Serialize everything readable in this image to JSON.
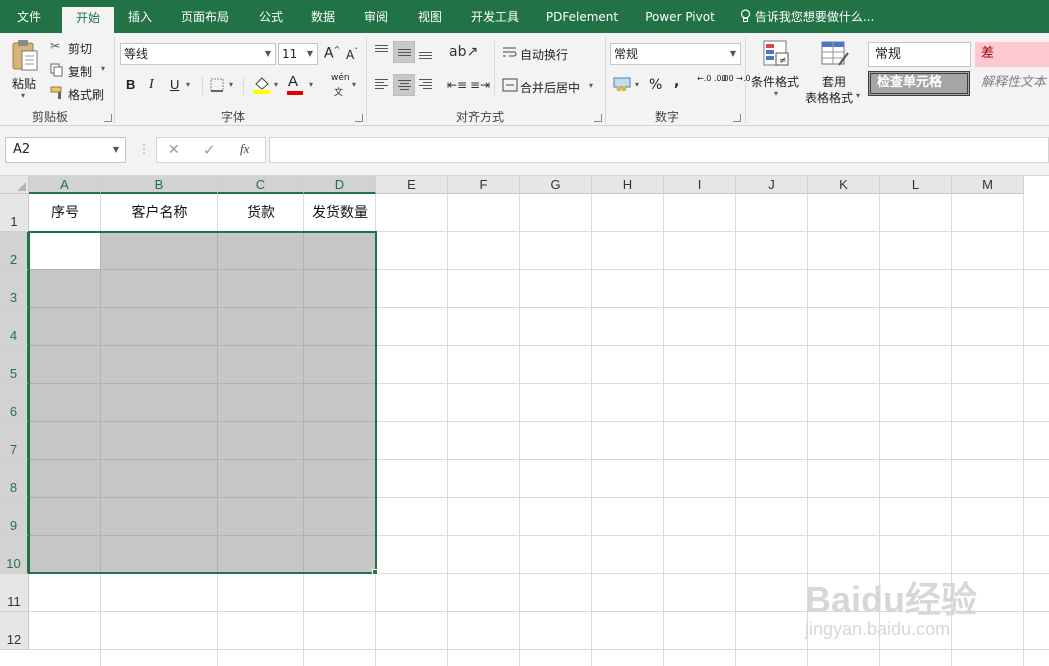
{
  "tabs": {
    "file": "文件",
    "home": "开始",
    "insert": "插入",
    "page_layout": "页面布局",
    "formulas": "公式",
    "data": "数据",
    "review": "审阅",
    "view": "视图",
    "developer": "开发工具",
    "pdfelement": "PDFelement",
    "power_pivot": "Power Pivot",
    "tell_me": "告诉我您想要做什么..."
  },
  "ribbon": {
    "clipboard": {
      "paste": "粘贴",
      "cut": "剪切",
      "copy": "复制",
      "format_painter": "格式刷",
      "group_label": "剪贴板"
    },
    "font": {
      "font_name": "等线",
      "font_size": "11",
      "bold": "B",
      "italic": "I",
      "underline": "U",
      "grow": "A",
      "shrink": "A",
      "font_color_letter": "A",
      "phonetic": "wén",
      "group_label": "字体"
    },
    "alignment": {
      "wrap_text": "自动换行",
      "merge_center": "合并后居中",
      "group_label": "对齐方式"
    },
    "number": {
      "format": "常规",
      "percent": "%",
      "comma": ",",
      "increase_decimal": "←.0 .00",
      "decrease_decimal": ".00 →.0",
      "group_label": "数字"
    },
    "styles": {
      "conditional_formatting": "条件格式",
      "format_as_table_line1": "套用",
      "format_as_table_line2": "表格格式",
      "style_normal": "常规",
      "style_bad": "差",
      "style_check_cell": "检查单元格",
      "style_explanatory": "解释性文本"
    }
  },
  "formula_bar": {
    "name_box": "A2",
    "fx": "fx",
    "cancel": "✕",
    "enter": "✓",
    "content": ""
  },
  "sheet": {
    "columns": [
      "A",
      "B",
      "C",
      "D",
      "E",
      "F",
      "G",
      "H",
      "I",
      "J",
      "K",
      "L",
      "M"
    ],
    "rows": [
      "1",
      "2",
      "3",
      "4",
      "5",
      "6",
      "7",
      "8",
      "9",
      "10",
      "11",
      "12"
    ],
    "header_cells": [
      "序号",
      "客户名称",
      "货款",
      "发货数量"
    ],
    "selection": "A2:D10"
  },
  "watermark": {
    "logo": "Baidu经验",
    "url": "jingyan.baidu.com"
  },
  "colors": {
    "excel_green": "#217346",
    "selection_gray": "#c6c6c6",
    "style_bad_bg": "#ffc7ce",
    "style_bad_text": "#9c0006"
  }
}
